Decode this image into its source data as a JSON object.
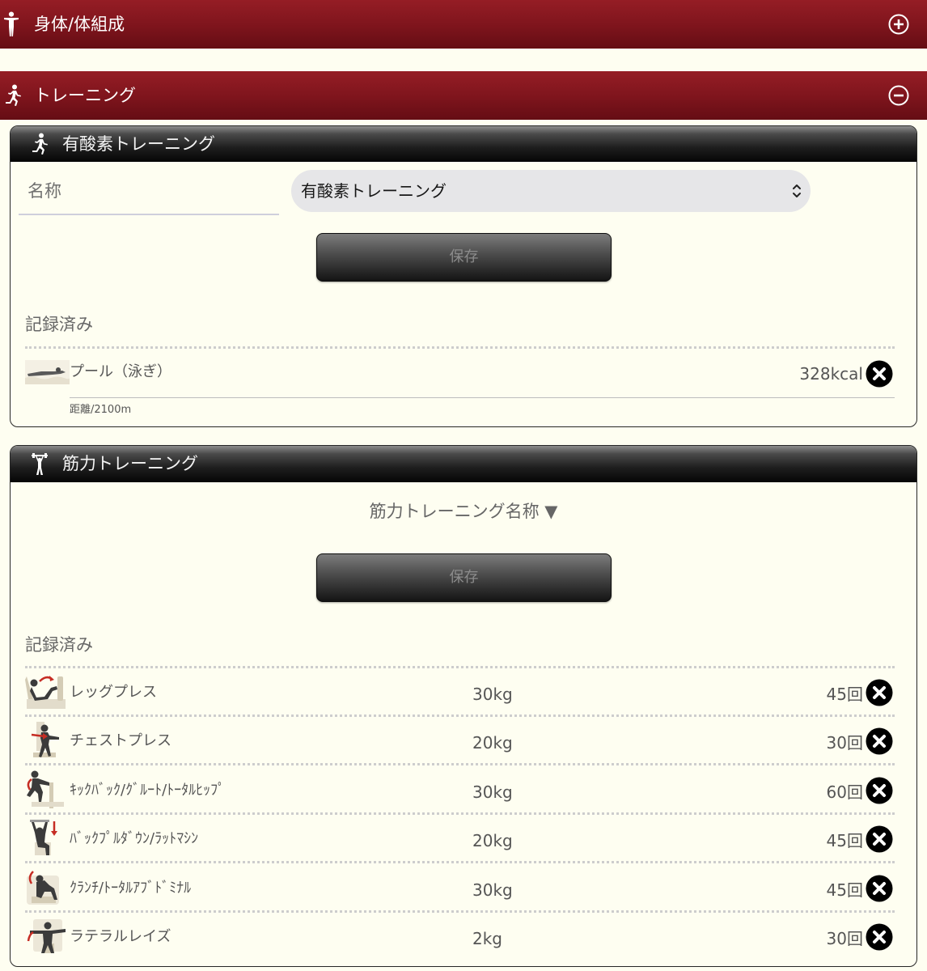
{
  "sections": [
    {
      "title": "身体/体組成",
      "icon": "standing-person-icon",
      "toggle_icon": "plus-circle-icon"
    },
    {
      "title": "トレーニング",
      "icon": "running-person-icon",
      "toggle_icon": "minus-circle-icon"
    }
  ],
  "aerobic_training": {
    "title": "有酸素トレーニング",
    "icon": "runner-icon",
    "name_label": "名称",
    "selected_value": "有酸素トレーニング",
    "save_label": "保存",
    "recorded_label": "記録済み",
    "records": [
      {
        "thumbnail": "swimming-thumbnail",
        "name": "プール（泳ぎ）",
        "amount": "328kcal",
        "detail": "距離/2100m"
      }
    ]
  },
  "strength_training": {
    "title": "筋力トレーニング",
    "icon": "weightlifter-icon",
    "selector_label": "筋力トレーニング名称 ▼",
    "save_label": "保存",
    "recorded_label": "記録済み",
    "records": [
      {
        "thumbnail": "leg-press-thumbnail",
        "name": "レッグプレス",
        "weight": "30kg",
        "reps": "45回"
      },
      {
        "thumbnail": "chest-press-thumbnail",
        "name": "チェストプレス",
        "weight": "20kg",
        "reps": "30回"
      },
      {
        "thumbnail": "kickback-thumbnail",
        "name": "ｷｯｸﾊﾞｯｸ/ｸﾞﾙｰﾄ/ﾄｰﾀﾙﾋｯﾌﾟ",
        "weight": "30kg",
        "reps": "60回"
      },
      {
        "thumbnail": "back-pulldown-thumbnail",
        "name": "ﾊﾞｯｸﾌﾟﾙﾀﾞｳﾝ/ﾗｯﾄﾏｼﾝ",
        "weight": "20kg",
        "reps": "45回"
      },
      {
        "thumbnail": "crunch-thumbnail",
        "name": "ｸﾗﾝﾁ/ﾄｰﾀﾙｱﾌﾞﾄﾞﾐﾅﾙ",
        "weight": "30kg",
        "reps": "45回"
      },
      {
        "thumbnail": "lateral-raise-thumbnail",
        "name": "ラテラルレイズ",
        "weight": "2kg",
        "reps": "30回"
      }
    ]
  },
  "delete_icon": "close-circle-icon",
  "colors": {
    "section_bar": "#80151d",
    "panel_header": "#111111",
    "background": "#fefef1",
    "select_background": "#e6e6e8",
    "delete_button": "#000000",
    "accent_arrow": "#c62d24"
  }
}
